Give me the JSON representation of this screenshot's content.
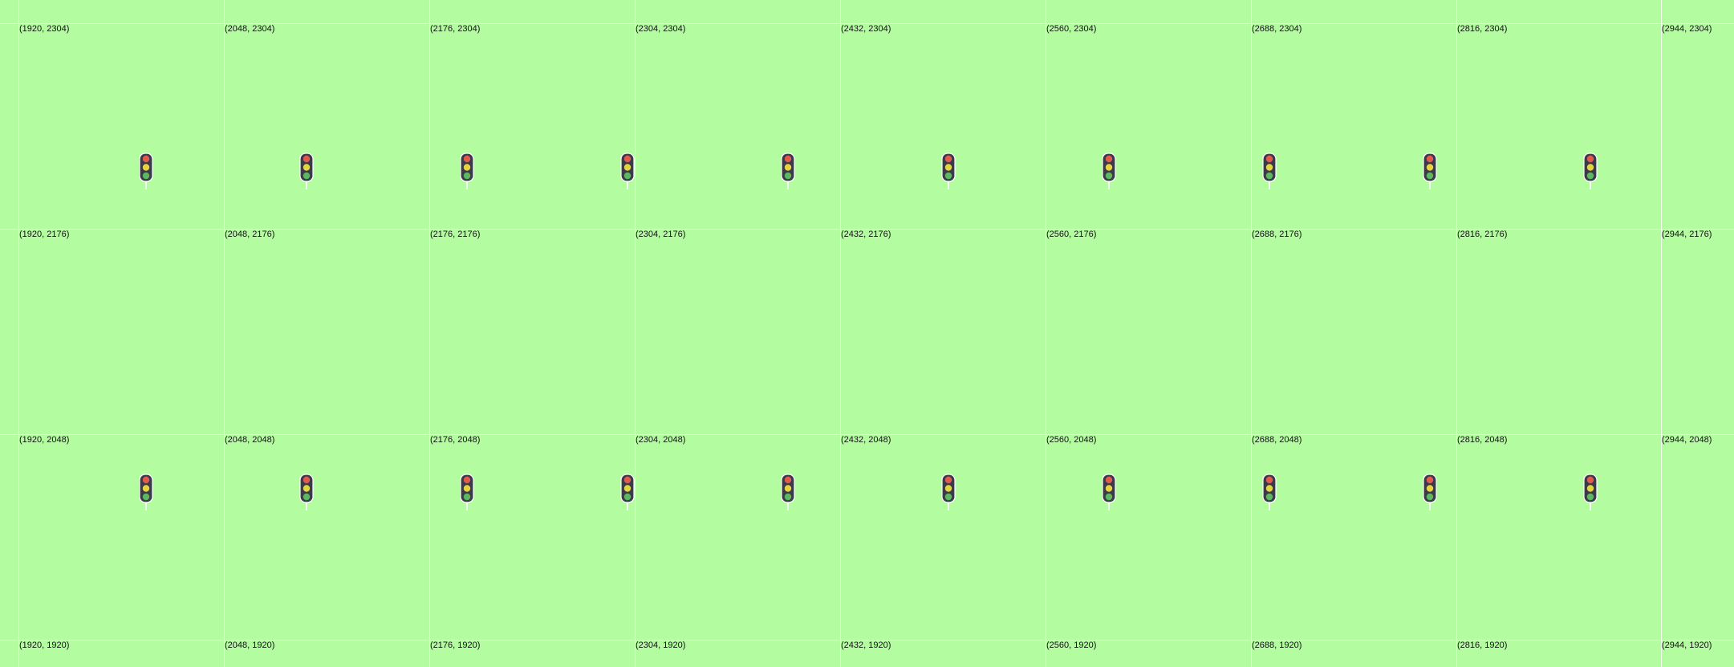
{
  "map": {
    "background_color": "#b3fca0",
    "grid_line_color": "#ffffff",
    "tile_columns_x": [
      1920,
      2048,
      2176,
      2304,
      2432,
      2560,
      2688,
      2816,
      2944
    ],
    "tile_rows_y": [
      2304,
      2176,
      2048,
      1920
    ],
    "tile_labels": [
      [
        "(1920, 2304)",
        "(2048, 2304)",
        "(2176, 2304)",
        "(2304, 2304)",
        "(2432, 2304)",
        "(2560, 2304)",
        "(2688, 2304)",
        "(2816, 2304)",
        "(2944, 2304)"
      ],
      [
        "(1920, 2176)",
        "(2048, 2176)",
        "(2176, 2176)",
        "(2304, 2176)",
        "(2432, 2176)",
        "(2560, 2176)",
        "(2688, 2176)",
        "(2816, 2176)",
        "(2944, 2176)"
      ],
      [
        "(1920, 2048)",
        "(2048, 2048)",
        "(2176, 2048)",
        "(2304, 2048)",
        "(2432, 2048)",
        "(2560, 2048)",
        "(2688, 2048)",
        "(2816, 2048)",
        "(2944, 2048)"
      ],
      [
        "(1920, 1920)",
        "(2048, 1920)",
        "(2176, 1920)",
        "(2304, 1920)",
        "(2432, 1920)",
        "(2560, 1920)",
        "(2688, 1920)",
        "(2816, 1920)",
        "(2944, 1920)"
      ]
    ],
    "traffic_signal": {
      "icon": "traffic-light-icon",
      "body_color": "#3b3a4a",
      "red_color": "#e05a4f",
      "yellow_color": "#e6d43a",
      "green_color": "#5cb85c",
      "rows": 2,
      "per_row": 10
    }
  }
}
